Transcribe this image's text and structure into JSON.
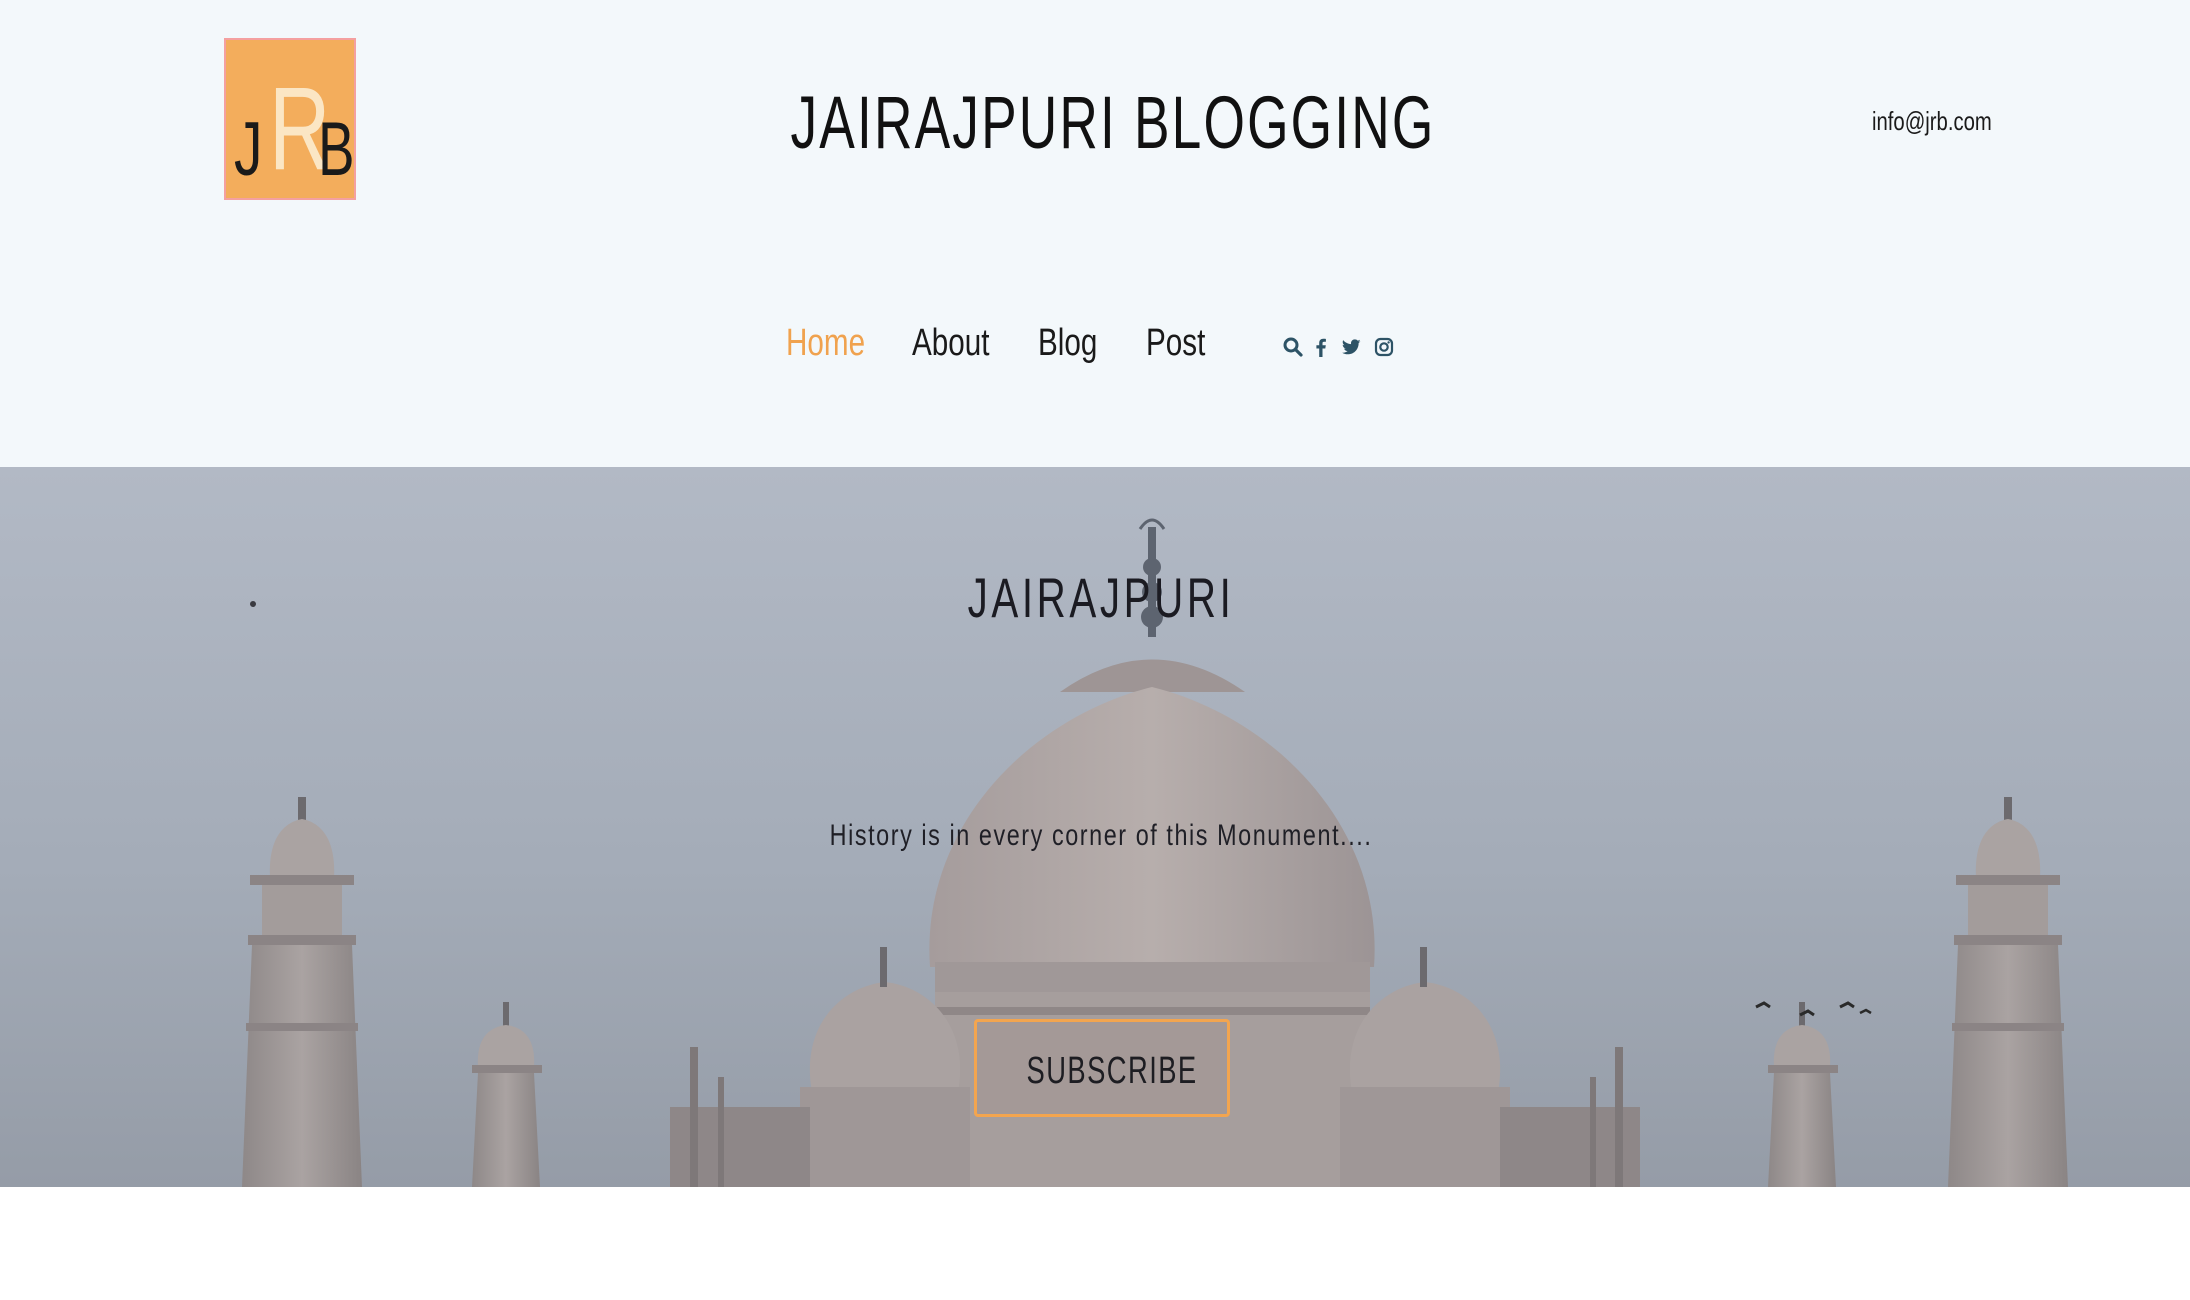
{
  "header": {
    "logo": {
      "letters": [
        "J",
        "R",
        "B"
      ],
      "bg_color": "#f3ad5c"
    },
    "title": "JAIRAJPURI BLOGGING",
    "email": "info@jrb.com",
    "nav": [
      {
        "label": "Home",
        "active": true
      },
      {
        "label": "About",
        "active": false
      },
      {
        "label": "Blog",
        "active": false
      },
      {
        "label": "Post",
        "active": false
      }
    ],
    "icons": [
      "search-icon",
      "facebook-icon",
      "twitter-icon",
      "instagram-icon"
    ],
    "accent_color": "#f0a24e",
    "icon_color": "#2d5366"
  },
  "hero": {
    "heading": "JAIRAJPURI",
    "subtitle": "History is in every corner of this Monument....",
    "button_label": "SUBSCRIBE",
    "button_border_color": "#f3a54f",
    "background": "Taj Mahal photo"
  }
}
